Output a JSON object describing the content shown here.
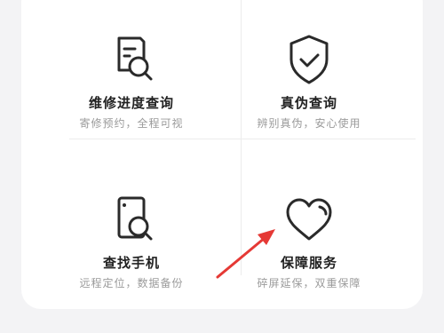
{
  "grid": {
    "items": [
      {
        "title": "维修进度查询",
        "subtitle": "寄修预约，全程可视",
        "icon": "repair-progress-icon"
      },
      {
        "title": "真伪查询",
        "subtitle": "辨别真伪，安心使用",
        "icon": "shield-check-icon"
      },
      {
        "title": "查找手机",
        "subtitle": "远程定位，数据备份",
        "icon": "find-phone-icon"
      },
      {
        "title": "保障服务",
        "subtitle": "碎屏延保，双重保障",
        "icon": "heart-icon"
      }
    ]
  },
  "annotation": {
    "arrow_color": "#e53935"
  }
}
